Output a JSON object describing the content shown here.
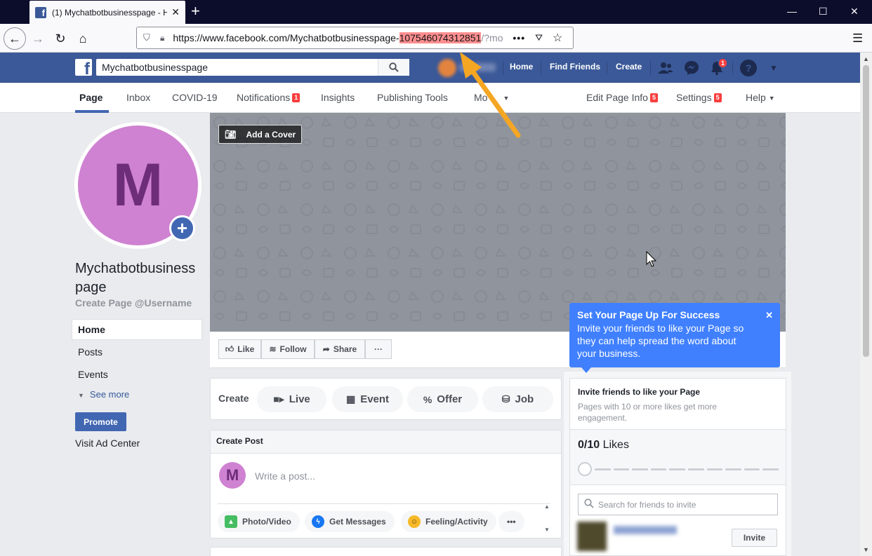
{
  "browser": {
    "tab_title": "(1) Mychatbotbusinesspage - H",
    "url_prefix": "https://www.facebook.com/Mychatbotbusinesspage-",
    "url_highlight": "107546074312851",
    "url_suffix": "/?mo",
    "url_more": "•••",
    "icons": [
      "back-icon",
      "forward-icon",
      "reload-icon",
      "home-icon",
      "shield-icon",
      "lock-icon",
      "pocket-icon",
      "bookmark-star-icon",
      "menu-icon"
    ]
  },
  "fb_header": {
    "search_value": "Mychatbotbusinesspage",
    "nav": {
      "home": "Home",
      "find_friends": "Find Friends",
      "create": "Create"
    },
    "notification_count": "1"
  },
  "page_nav": {
    "page": "Page",
    "inbox": "Inbox",
    "covid": "COVID-19",
    "notifications": "Notifications",
    "notifications_badge": "1",
    "insights": "Insights",
    "publishing_tools": "Publishing Tools",
    "more": "Mo",
    "edit_page_info": "Edit Page Info",
    "edit_page_info_badge": "5",
    "settings": "Settings",
    "settings_badge": "5",
    "help": "Help"
  },
  "sidebar": {
    "avatar_letter": "M",
    "page_name": "Mychatbotbusiness page",
    "username_link": "Create Page @Username",
    "home": "Home",
    "posts": "Posts",
    "events": "Events",
    "see_more": "See more",
    "promote": "Promote",
    "visit_ad_center": "Visit Ad Center"
  },
  "cover": {
    "add_cover": "Add a Cover"
  },
  "actions": {
    "like": "Like",
    "follow": "Follow",
    "share": "Share",
    "more": "···"
  },
  "create_box": {
    "label": "Create",
    "live": "Live",
    "event": "Event",
    "offer": "Offer",
    "job": "Job"
  },
  "create_post": {
    "title": "Create Post",
    "avatar_letter": "M",
    "placeholder": "Write a post...",
    "photo_video": "Photo/Video",
    "get_messages": "Get Messages",
    "feeling_activity": "Feeling/Activity",
    "more": "•••"
  },
  "tooltip": {
    "title": "Set Your Page Up For Success",
    "body": "Invite your friends to like your Page so they can help spread the word about your business.",
    "close": "✕"
  },
  "invite_widget": {
    "title": "Invite friends to like your Page",
    "subtitle": "Pages with 10 or more likes get more engagement.",
    "likes_count": "0/10",
    "likes_label": "Likes",
    "likes_current": 0,
    "likes_goal": 10,
    "search_placeholder": "Search for friends to invite",
    "invite": "Invite"
  },
  "colors": {
    "fb_blue": "#3b5998",
    "accent_blue": "#4267b2",
    "tooltip_blue": "#4080ff",
    "avatar_purple": "#cf82d1",
    "url_highlight": "#ff8f8f",
    "annotation_arrow": "#f5a623"
  }
}
